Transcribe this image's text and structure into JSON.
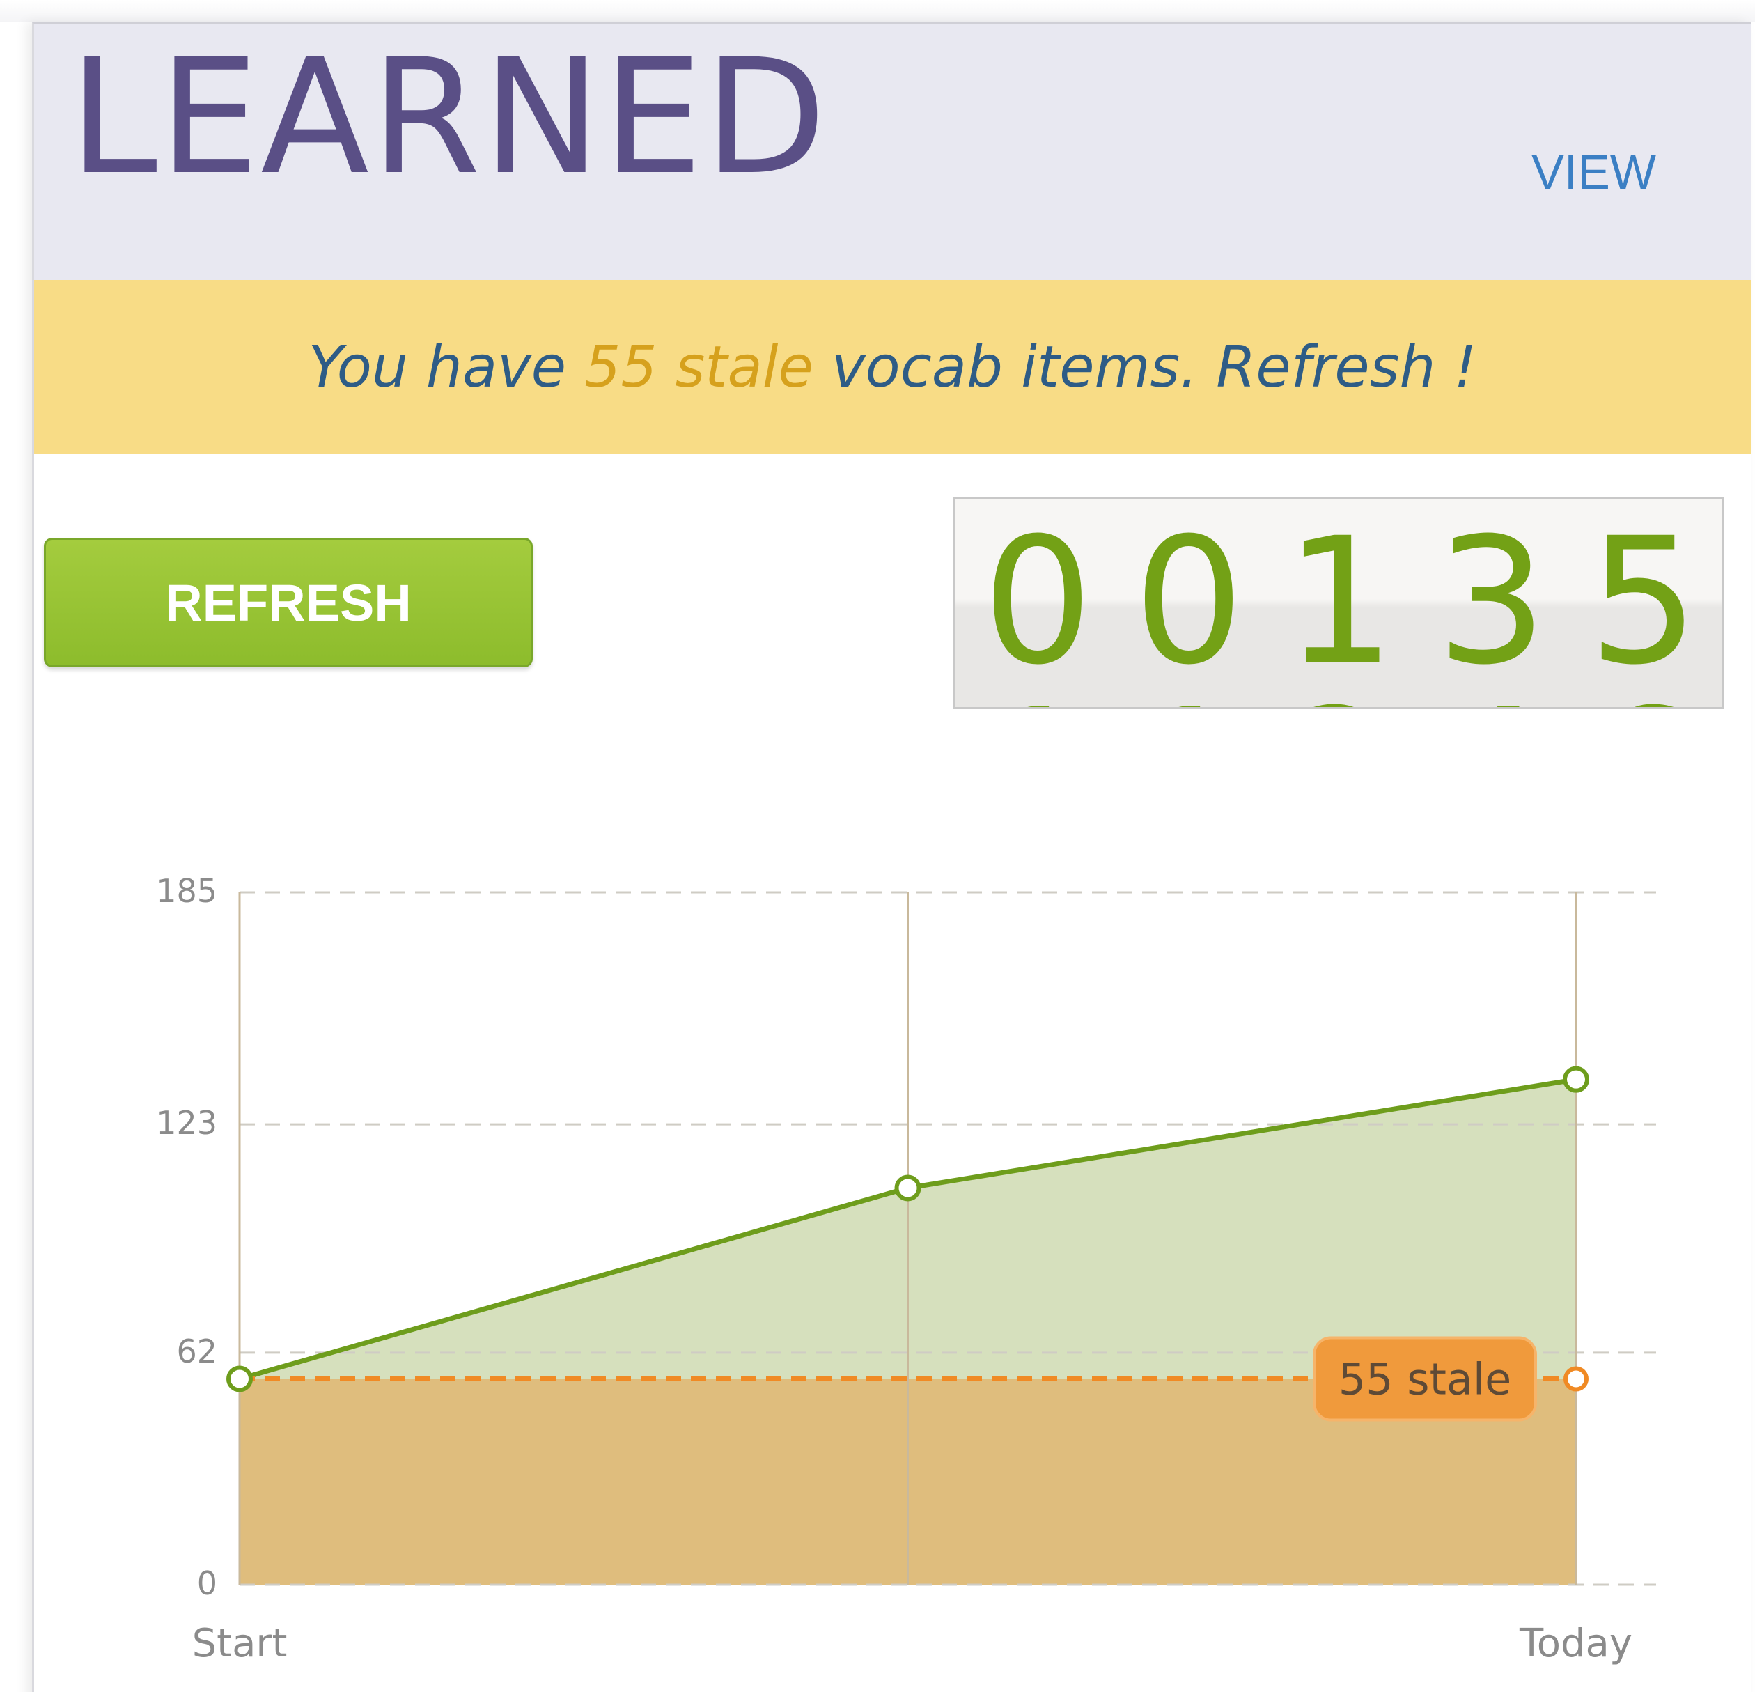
{
  "header": {
    "title": "LEARNED",
    "view_label": "VIEW"
  },
  "notice": {
    "prefix": "You have",
    "highlight": "55 stale",
    "middle": "vocab items.",
    "link": "Refresh !"
  },
  "refresh_button": {
    "label": "REFRESH"
  },
  "counter": {
    "digits": [
      "0",
      "0",
      "1",
      "3",
      "5"
    ]
  },
  "colors": {
    "accent_green": "#8dbc2c",
    "digit_green": "#73a116",
    "title_purple": "#5a4f86",
    "notice_yellow": "#f8dc86",
    "stale_orange": "#f08a24",
    "link_blue": "#3b7fc4"
  },
  "chart_data": {
    "type": "area",
    "x": [
      "Start",
      "",
      "Today"
    ],
    "ylim": [
      0,
      185
    ],
    "y_ticks": [
      0,
      62,
      123,
      185
    ],
    "x_tick_labels": [
      "Start",
      "Today"
    ],
    "grid": true,
    "series": [
      {
        "values": [
          55,
          106,
          135
        ],
        "color": "#6e9d1c",
        "fill": "#d6e0bd"
      },
      {
        "values": [
          55,
          55,
          55
        ],
        "color": "#f08a24",
        "fill": "#dfbd7d"
      }
    ],
    "annotations": [
      {
        "text": "55 stale",
        "series_index": 1,
        "point_index": 2
      }
    ]
  }
}
